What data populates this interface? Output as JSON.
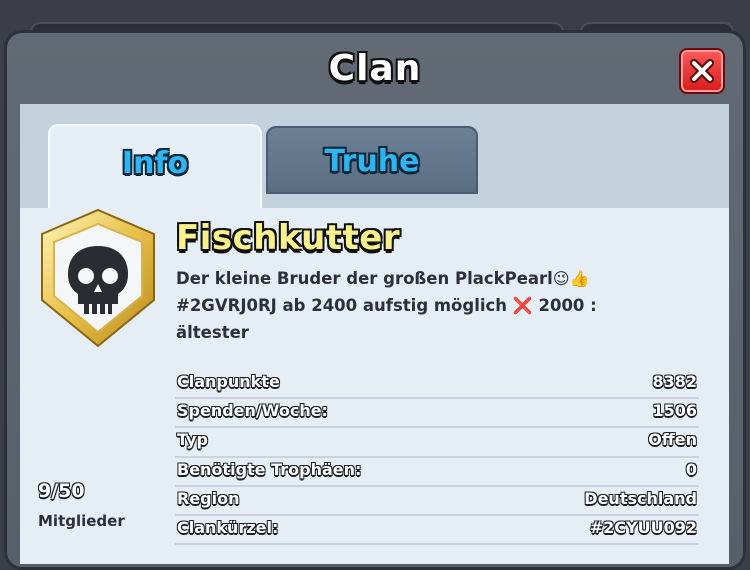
{
  "window": {
    "title": "Clan"
  },
  "tabs": [
    {
      "label": "Info",
      "selected": true
    },
    {
      "label": "Truhe",
      "selected": false
    }
  ],
  "clan": {
    "name": "Fischkutter",
    "description_line1": "Der kleine Bruder der großen PlackPearl",
    "description_emoji1": "😉👍",
    "description_line2": "#2GVRJ0RJ ab 2400 aufstig möglich",
    "description_mark": "❌",
    "description_line2_end": "2000 :",
    "description_line3": "ältester",
    "badge_icon": "skull-icon"
  },
  "stats": [
    {
      "label": "Clanpunkte",
      "value": "8382"
    },
    {
      "label": "Spenden/Woche:",
      "value": "1506"
    },
    {
      "label": "Typ",
      "value": "Offen"
    },
    {
      "label": "Benötigte Trophäen:",
      "value": "0"
    },
    {
      "label": "Region",
      "value": "Deutschland"
    },
    {
      "label": "Clankürzel:",
      "value": "#2CYUU092"
    }
  ],
  "members": {
    "count": "9/50",
    "label": "Mitglieder"
  },
  "colors": {
    "tab_text": "#2fb4f2",
    "clan_name": "#f8f08a",
    "close_button": "#e02a2a",
    "panel": "#5e6670"
  }
}
